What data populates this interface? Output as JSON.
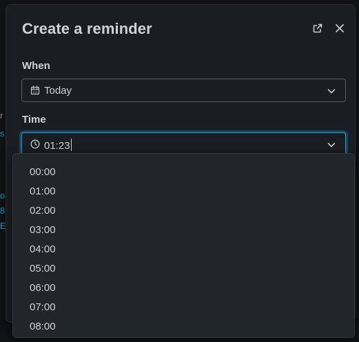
{
  "dialog": {
    "title": "Create a reminder",
    "icons": {
      "open_in_new": "open-in-new-icon",
      "close": "close-icon"
    }
  },
  "when": {
    "label": "When",
    "value": "Today",
    "icon": "calendar-icon"
  },
  "time": {
    "label": "Time",
    "value": "01:23",
    "icon": "clock-icon"
  },
  "time_options": [
    "00:00",
    "01:00",
    "02:00",
    "03:00",
    "04:00",
    "05:00",
    "06:00",
    "07:00",
    "08:00"
  ],
  "background_fragments": [
    "r",
    "s",
    "o",
    "8",
    "E"
  ],
  "colors": {
    "accent": "#1d9bd1",
    "surface": "#1a1d21",
    "dropdown": "#222529",
    "text": "#d1d2d3"
  }
}
